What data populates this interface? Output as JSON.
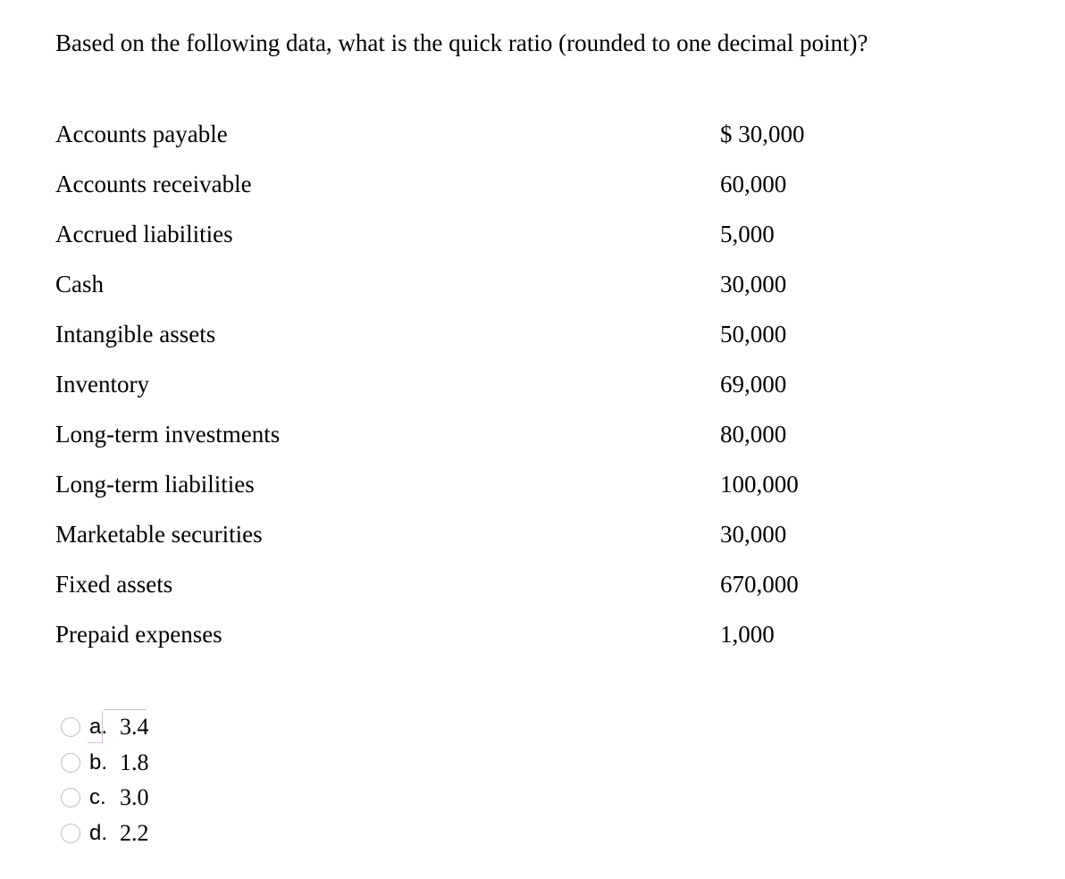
{
  "question": "Based on the following data, what is the quick ratio (rounded to one decimal point)?",
  "items": [
    {
      "label": "Accounts payable",
      "value": "$ 30,000"
    },
    {
      "label": "Accounts receivable",
      "value": "60,000"
    },
    {
      "label": "Accrued liabilities",
      "value": "5,000"
    },
    {
      "label": "Cash",
      "value": "30,000"
    },
    {
      "label": "Intangible assets",
      "value": "50,000"
    },
    {
      "label": "Inventory",
      "value": "69,000"
    },
    {
      "label": "Long-term investments",
      "value": "80,000"
    },
    {
      "label": "Long-term liabilities",
      "value": "100,000"
    },
    {
      "label": "Marketable securities",
      "value": "30,000"
    },
    {
      "label": "Fixed assets",
      "value": "670,000"
    },
    {
      "label": "Prepaid expenses",
      "value": "1,000"
    }
  ],
  "answers": [
    {
      "letter": "a.",
      "value": "3.4"
    },
    {
      "letter": "b.",
      "value": "1.8"
    },
    {
      "letter": "c.",
      "value": "3.0"
    },
    {
      "letter": "d.",
      "value": "2.2"
    }
  ]
}
